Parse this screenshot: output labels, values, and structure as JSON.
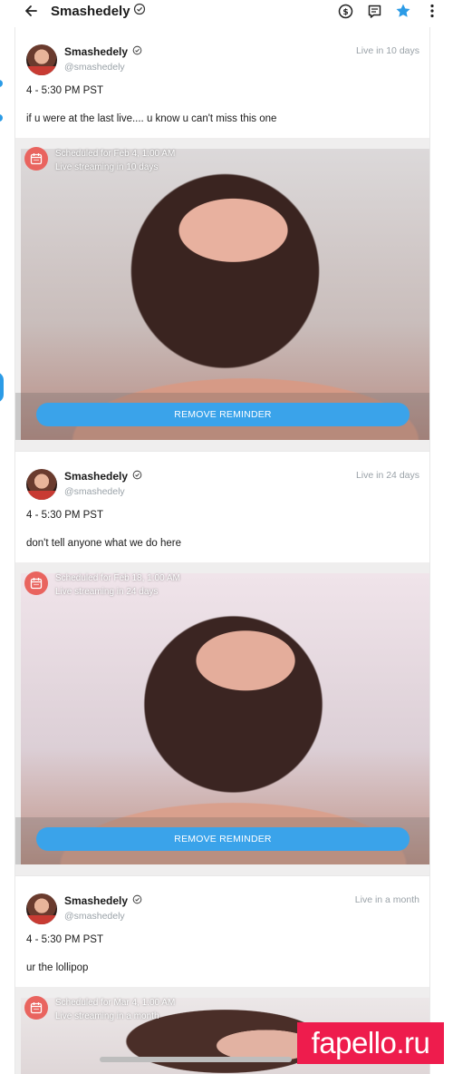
{
  "header": {
    "title": "Smashedely",
    "icons": [
      "back-arrow-icon",
      "verified-icon",
      "dollar-icon",
      "message-icon",
      "star-icon",
      "more-icon"
    ],
    "accent": "#2b9be6"
  },
  "posts": [
    {
      "name": "Smashedely",
      "handle": "@smashedely",
      "when": "Live in 10 days",
      "time": "4 - 5:30 PM PST",
      "caption": "if u were at the last live.... u know u can't miss this one",
      "scheduled": "Scheduled for Feb 4, 1:00 AM",
      "streaming": "Live streaming in 10 days",
      "button": "REMOVE REMINDER"
    },
    {
      "name": "Smashedely",
      "handle": "@smashedely",
      "when": "Live in 24 days",
      "time": "4 - 5:30 PM PST",
      "caption": "don't tell anyone what we do here",
      "scheduled": "Scheduled for Feb 18, 1:00 AM",
      "streaming": "Live streaming in 24 days",
      "button": "REMOVE REMINDER"
    },
    {
      "name": "Smashedely",
      "handle": "@smashedely",
      "when": "Live in a month",
      "time": "4 - 5:30 PM PST",
      "caption": "ur the lollipop",
      "scheduled": "Scheduled for Mar 4, 1:00 AM",
      "streaming": "Live streaming in a month"
    }
  ],
  "watermark": "fapello.ru",
  "colors": {
    "button": "#3aa3ea",
    "calendar": "#e9645f",
    "watermark": "#ee1c4d"
  }
}
